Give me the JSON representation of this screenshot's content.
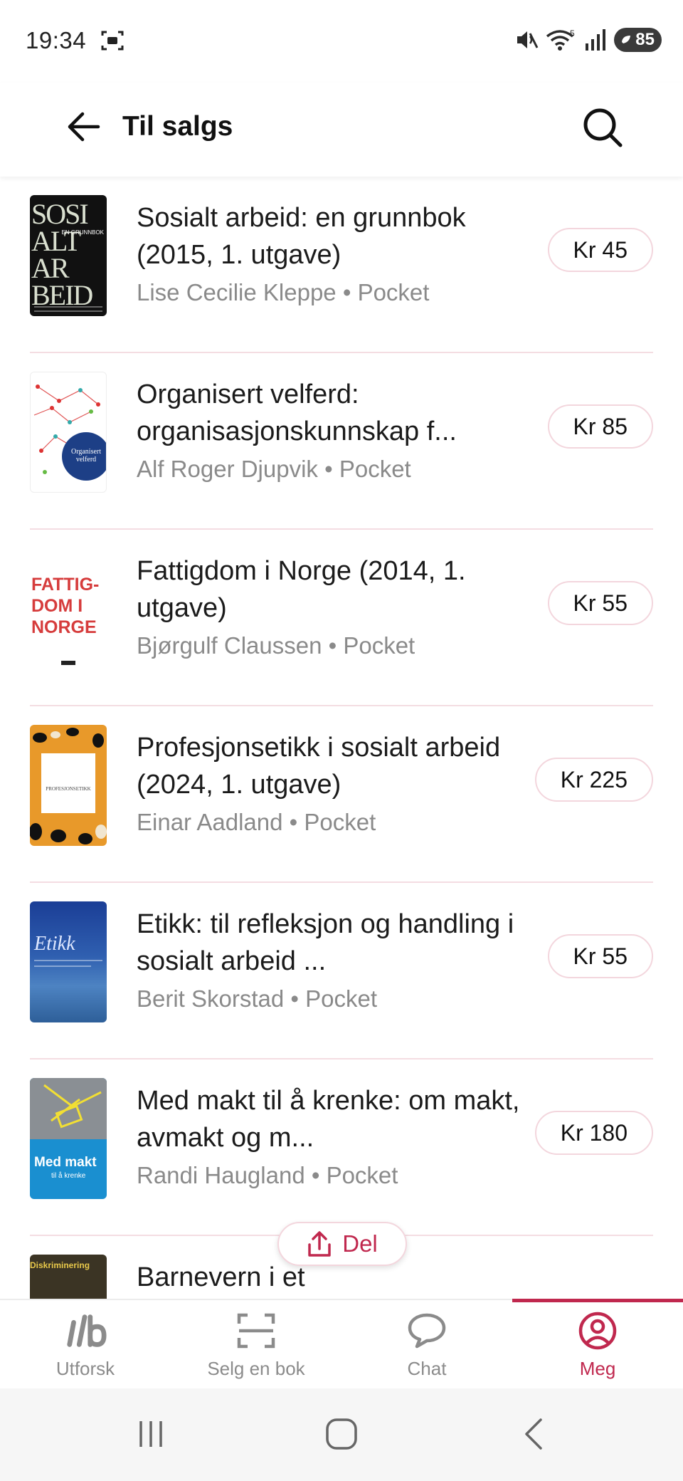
{
  "status_bar": {
    "time": "19:34",
    "battery": "85"
  },
  "app_bar": {
    "title": "Til salgs"
  },
  "books": [
    {
      "title": "Sosialt arbeid: en grunnbok (2015, 1. utgave)",
      "author": "Lise Cecilie Kleppe",
      "format": "Pocket",
      "price": "Kr 45",
      "cover_text": "SOSI ALT AR BEID",
      "cover_subtitle": "EN GRUNNBOK"
    },
    {
      "title": "Organisert velferd: organisasjonskunnskap f...",
      "author": "Alf Roger Djupvik",
      "format": "Pocket",
      "price": "Kr 85",
      "cover_text": "Organisert velferd"
    },
    {
      "title": "Fattigdom i Norge (2014, 1. utgave)",
      "author": "Bjørgulf Claussen",
      "format": "Pocket",
      "price": "Kr 55",
      "cover_text": "FATTIG- DOM I NORGE"
    },
    {
      "title": "Profesjonsetikk i sosialt arbeid (2024, 1. utgave)",
      "author": "Einar Aadland",
      "format": "Pocket",
      "price": "Kr 225",
      "cover_text": "PROFESJONSETIKK"
    },
    {
      "title": "Etikk: til refleksjon og handling i sosialt arbeid ...",
      "author": "Berit Skorstad",
      "format": "Pocket",
      "price": "Kr 55",
      "cover_text": "Etikk"
    },
    {
      "title": "Med makt til å krenke: om makt, avmakt og m...",
      "author": "Randi Haugland",
      "format": "Pocket",
      "price": "Kr 180",
      "cover_text": "Med makt",
      "cover_subtitle": "til å krenke"
    },
    {
      "title": "Barnevern i et",
      "author": "",
      "format": "",
      "price": "",
      "cover_text": "Diskriminering"
    }
  ],
  "share_button": {
    "label": "Del"
  },
  "bottom_nav": [
    {
      "label": "Utforsk",
      "icon": "logo-icon"
    },
    {
      "label": "Selg en bok",
      "icon": "scan-icon"
    },
    {
      "label": "Chat",
      "icon": "chat-bubble-icon"
    },
    {
      "label": "Meg",
      "icon": "profile-icon",
      "active": true
    }
  ],
  "colors": {
    "accent": "#c0284e",
    "divider": "#f4dde2",
    "muted_text": "#8a8a8a"
  }
}
